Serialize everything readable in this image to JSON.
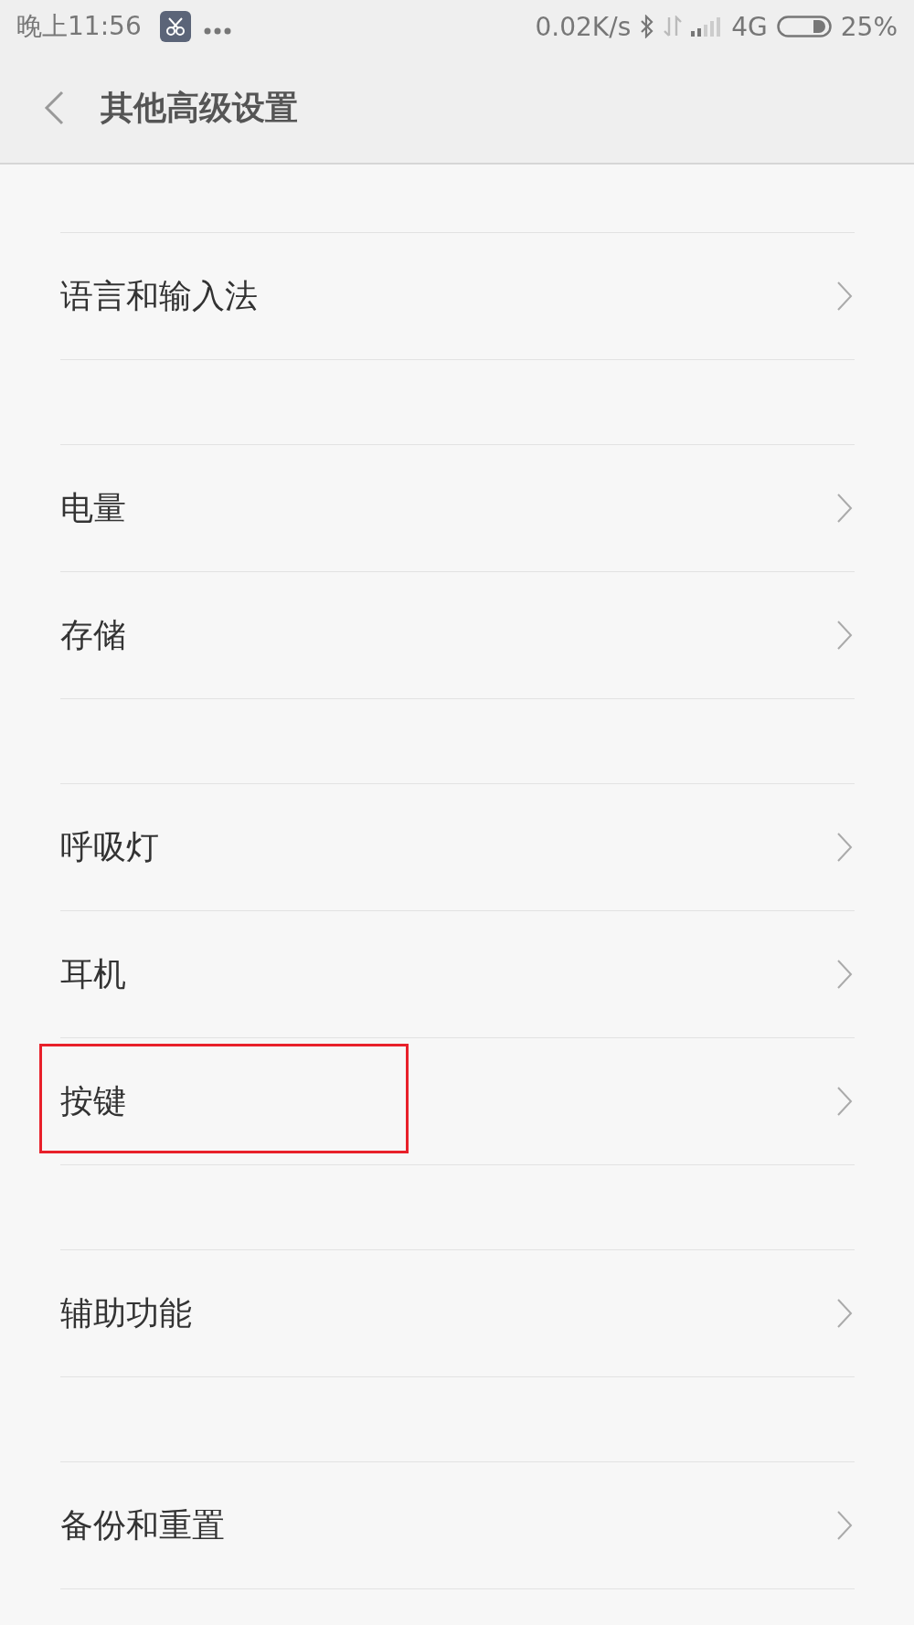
{
  "status_bar": {
    "time": "晚上11:56",
    "speed": "0.02K/s",
    "network": "4G",
    "battery": "25%"
  },
  "header": {
    "title": "其他高级设置"
  },
  "sections": [
    {
      "items": [
        {
          "label": "语言和输入法",
          "highlighted": false
        }
      ]
    },
    {
      "items": [
        {
          "label": "电量",
          "highlighted": false
        },
        {
          "label": "存储",
          "highlighted": false
        }
      ]
    },
    {
      "items": [
        {
          "label": "呼吸灯",
          "highlighted": false
        },
        {
          "label": "耳机",
          "highlighted": false
        },
        {
          "label": "按键",
          "highlighted": true
        }
      ]
    },
    {
      "items": [
        {
          "label": "辅助功能",
          "highlighted": false
        }
      ]
    },
    {
      "items": [
        {
          "label": "备份和重置",
          "highlighted": false
        }
      ]
    }
  ]
}
